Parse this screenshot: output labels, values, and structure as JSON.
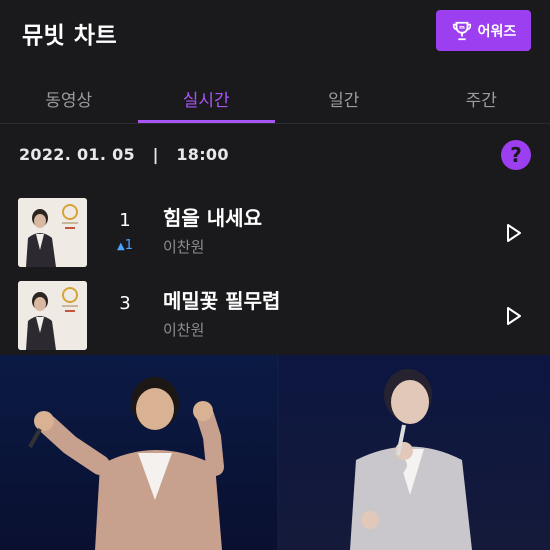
{
  "header": {
    "title": "뮤빗 차트",
    "awards_label": "어워즈",
    "awards_icon": "trophy-icon"
  },
  "tabs": [
    {
      "label": "동영상",
      "active": false
    },
    {
      "label": "실시간",
      "active": true
    },
    {
      "label": "일간",
      "active": false
    },
    {
      "label": "주간",
      "active": false
    }
  ],
  "chart_info": {
    "datetime": "2022. 01. 05   |   18:00",
    "help_symbol": "?"
  },
  "tracks": [
    {
      "rank": "1",
      "change": "1",
      "change_direction": "up",
      "title": "힘을 내세요",
      "artist": "이찬원"
    },
    {
      "rank": "3",
      "change": "",
      "change_direction": "",
      "title": "메밀꽃 필무렵",
      "artist": "이찬원"
    }
  ],
  "colors": {
    "accent": "#9b3ff0",
    "background": "#1a1a1c",
    "rank_up": "#4aa3ff"
  }
}
